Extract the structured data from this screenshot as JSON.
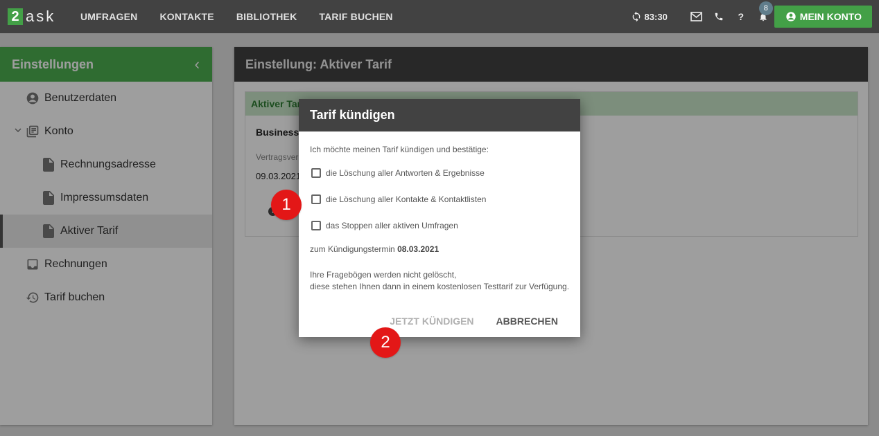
{
  "topbar": {
    "logo_number": "2",
    "logo_text": "ask",
    "nav": [
      "UMFRAGEN",
      "KONTAKTE",
      "BIBLIOTHEK",
      "TARIF BUCHEN"
    ],
    "timer": "83:30",
    "notification_count": "8",
    "account_label": "MEIN KONTO",
    "help_label": "?"
  },
  "sidebar": {
    "title": "Einstellungen",
    "collapse_label": "‹",
    "items": [
      {
        "label": "Benutzerdaten",
        "icon": "user-circle-icon"
      },
      {
        "label": "Konto",
        "icon": "library-icon"
      },
      {
        "label": "Rechnungsadresse",
        "icon": "document-icon"
      },
      {
        "label": "Impressumsdaten",
        "icon": "document-icon"
      },
      {
        "label": "Aktiver Tarif",
        "icon": "document-icon",
        "active": true
      },
      {
        "label": "Rechnungen",
        "icon": "inbox-icon"
      },
      {
        "label": "Tarif buchen",
        "icon": "history-icon"
      }
    ]
  },
  "main": {
    "title": "Einstellung: Aktiver Tarif",
    "card": {
      "header": "Aktiver Tarif",
      "plan": "Businesst",
      "label": "Vertragsver",
      "date": "09.03.2021",
      "info_label": "i"
    }
  },
  "dialog": {
    "title": "Tarif kündigen",
    "intro": "Ich möchte meinen Tarif kündigen und bestätige:",
    "checkboxes": [
      "die Löschung aller Antworten & Ergebnisse",
      "die Löschung aller Kontakte & Kontaktlisten",
      "das Stoppen aller aktiven Umfragen"
    ],
    "term_prefix": "zum Kündigungstermin",
    "term_date": "08.03.2021",
    "note_line1": "Ihre Fragebögen werden nicht gelöscht,",
    "note_line2": "diese stehen Ihnen dann in einem kostenlosen Testtarif zur Verfügung.",
    "confirm_label": "JETZT KÜNDIGEN",
    "cancel_label": "ABBRECHEN"
  },
  "markers": [
    "1",
    "2"
  ],
  "colors": {
    "brand_green": "#43a047",
    "dark_header": "#424242",
    "marker_red": "#e31717"
  }
}
